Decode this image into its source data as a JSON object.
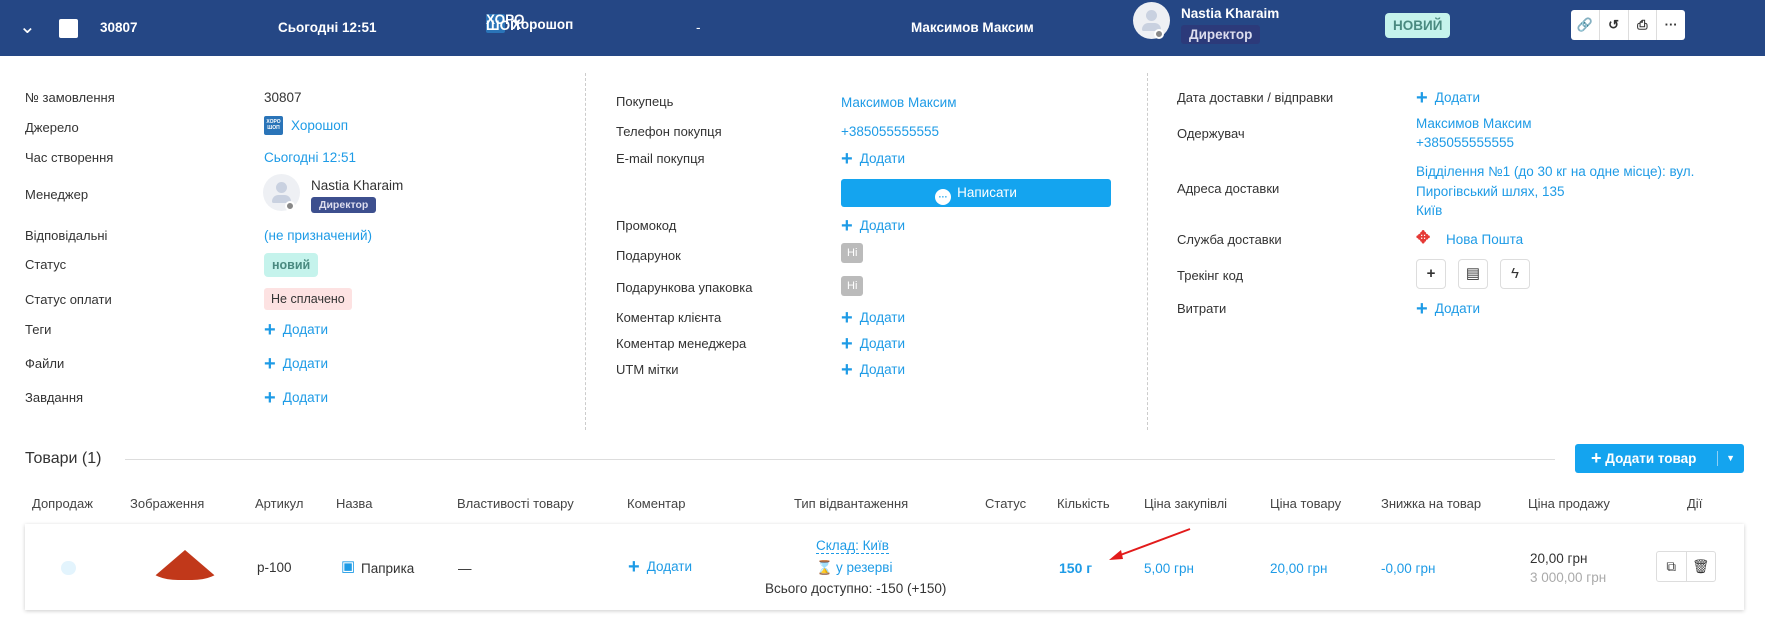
{
  "header": {
    "order_id": "30807",
    "created": "Сьогодні 12:51",
    "source": "Хорошоп",
    "source_logo": "ХОРО ШОП",
    "separator": "-",
    "customer": "Максимов Максим",
    "manager_name": "Nastia Kharaim",
    "manager_role": "Директор",
    "status": "НОВИЙ",
    "actions": [
      "link-icon",
      "history-icon",
      "print-icon",
      "more-icon"
    ]
  },
  "left": {
    "labels": [
      "№ замовлення",
      "Джерело",
      "Час створення",
      "Менеджер",
      "Відповідальні",
      "Статус",
      "Статус оплати",
      "Теги",
      "Файли",
      "Завдання"
    ],
    "order_id": "30807",
    "source": "Хорошоп",
    "created": "Сьогодні 12:51",
    "manager_name": "Nastia Kharaim",
    "manager_role": "Директор",
    "responsible": "(не призначений)",
    "status": "новий",
    "payment_status": "Не сплачено",
    "add": "Додати"
  },
  "middle": {
    "labels": [
      "Покупець",
      "Телефон покупця",
      "E-mail покупця",
      "Промокод",
      "Подарунок",
      "Подарункова упаковка",
      "Коментар клієнта",
      "Коментар менеджера",
      "UTM мітки"
    ],
    "buyer": "Максимов Максим",
    "phone": "+385055555555",
    "write_button": "Написати",
    "no": "Ні",
    "add": "Додати"
  },
  "right": {
    "labels": [
      "Дата доставки / відправки",
      "Одержувач",
      "Адреса доставки",
      "Служба доставки",
      "Трекінг код",
      "Витрати"
    ],
    "recipient_name": "Максимов Максим",
    "recipient_phone": "+385055555555",
    "address_1": "Відділення №1 (до 30 кг на одне місце): вул.",
    "address_2": "Пирогівський шлях, 135",
    "address_3": "Київ",
    "delivery_service": "Нова Пошта",
    "add": "Додати"
  },
  "products": {
    "title": "Товари (1)",
    "add_button": "Додати товар",
    "columns": [
      "Допродаж",
      "Зображення",
      "Артикул",
      "Назва",
      "Властивості товару",
      "Коментар",
      "Тип відвантаження",
      "Статус",
      "Кількість",
      "Ціна закупівлі",
      "Ціна товару",
      "Знижка на товар",
      "Ціна продажу",
      "Дії"
    ],
    "rows": [
      {
        "sku": "p-100",
        "name": "Паприка",
        "properties": "—",
        "comment_add": "Додати",
        "warehouse": "Склад: Київ",
        "reserve": "у резерві",
        "available": "Всього доступно: -150 (+150)",
        "quantity": "150 г",
        "purchase_price": "5,00 грн",
        "price": "20,00 грн",
        "discount": "-0,00 грн",
        "sale_price": "20,00 грн",
        "total": "3 000,00 грн"
      }
    ]
  },
  "colors": {
    "header": "#254785",
    "link": "#1e9be6",
    "accent": "#1aa3e8"
  }
}
